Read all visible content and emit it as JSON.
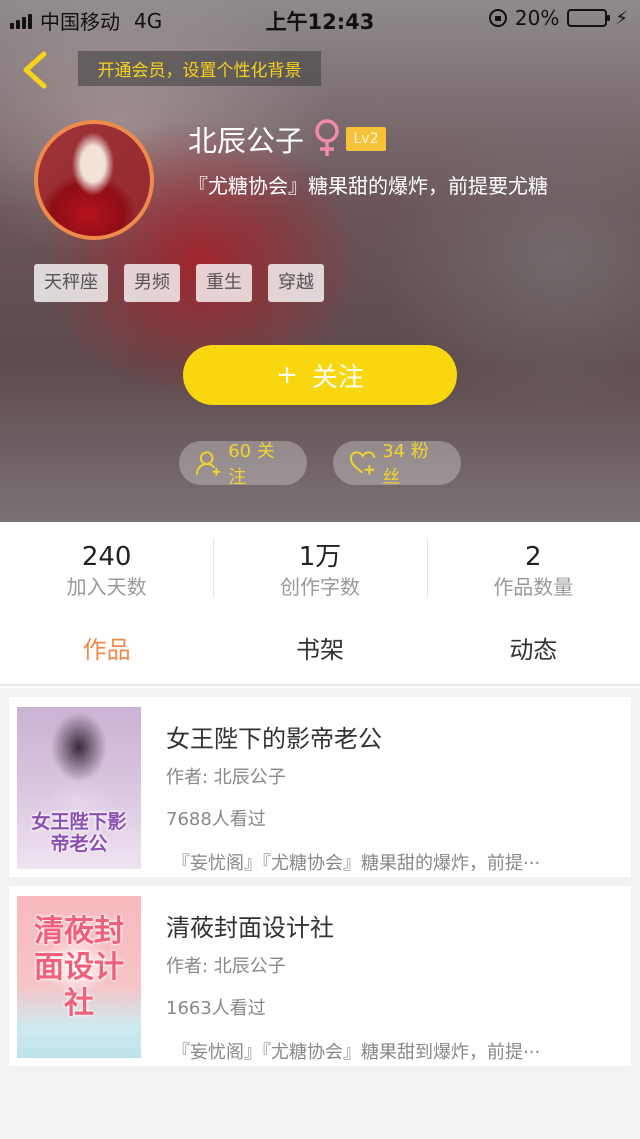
{
  "status_bar": {
    "carrier": "中国移动",
    "network": "4G",
    "time": "上午12:43",
    "battery": "20%",
    "battery_level": 0.2
  },
  "header": {
    "vip_banner": "开通会员，设置个性化背景"
  },
  "profile": {
    "name": "北辰公子",
    "gender_icon": "female-symbol-icon",
    "level": "Lv2",
    "signature": "『尤糖协会』糖果甜的爆炸，前提要尤糖",
    "tags": [
      "天秤座",
      "男频",
      "重生",
      "穿越"
    ]
  },
  "actions": {
    "follow_plus": "+",
    "follow_label": "关注",
    "following": "60 关注",
    "fans": "34 粉丝"
  },
  "stats": [
    {
      "value": "240",
      "label": "加入天数"
    },
    {
      "value": "1万",
      "label": "创作字数"
    },
    {
      "value": "2",
      "label": "作品数量"
    }
  ],
  "tabs": [
    "作品",
    "书架",
    "动态"
  ],
  "books": [
    {
      "title": "女王陛下的影帝老公",
      "author": "作者: 北辰公子",
      "views": "7688人看过",
      "desc": "『妄忧阁』『尤糖协会』糖果甜的爆炸，前提···",
      "cover_text": "女王陛下影帝老公"
    },
    {
      "title": "清莜封面设计社",
      "author": "作者: 北辰公子",
      "views": "1663人看过",
      "desc": "『妄忧阁』『尤糖协会』糖果甜到爆炸，前提···",
      "cover_text": "清莜封面设计社"
    }
  ],
  "colors": {
    "accent_yellow": "#f8d70f",
    "accent_orange": "#f08a4b",
    "banner_text": "#f7d31a"
  }
}
